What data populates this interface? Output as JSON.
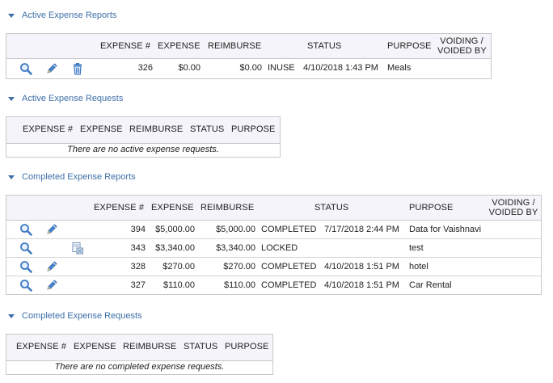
{
  "sections": {
    "active_reports": {
      "title": "Active Expense Reports"
    },
    "active_requests": {
      "title": "Active Expense Requests"
    },
    "completed_reports": {
      "title": "Completed Expense Reports"
    },
    "completed_requests": {
      "title": "Completed Expense Requests"
    }
  },
  "headers": {
    "expense_num": "EXPENSE #",
    "expense": "EXPENSE",
    "reimburse": "REIMBURSE",
    "status": "STATUS",
    "purpose": "PURPOSE",
    "voiding_line1": "VOIDING /",
    "voiding_line2": "VOIDED BY"
  },
  "active_reports_rows": [
    {
      "num": "326",
      "expense": "$0.00",
      "reimburse": "$0.00",
      "status": "INUSE",
      "date": "4/10/2018 1:43 PM",
      "purpose": "Meals"
    }
  ],
  "active_requests_empty": "There are no active expense requests.",
  "completed_reports_rows": [
    {
      "num": "394",
      "expense": "$5,000.00",
      "reimburse": "$5,000.00",
      "status": "COMPLETED",
      "date": "7/17/2018 2:44 PM",
      "purpose": "Data for Vaishnavi"
    },
    {
      "num": "343",
      "expense": "$3,340.00",
      "reimburse": "$3,340.00",
      "status": "LOCKED",
      "date": "",
      "purpose": "test"
    },
    {
      "num": "328",
      "expense": "$270.00",
      "reimburse": "$270.00",
      "status": "COMPLETED",
      "date": "4/10/2018 1:51 PM",
      "purpose": "hotel"
    },
    {
      "num": "327",
      "expense": "$110.00",
      "reimburse": "$110.00",
      "status": "COMPLETED",
      "date": "4/10/2018 1:51 PM",
      "purpose": "Car Rental"
    }
  ],
  "completed_requests_empty": "There are no completed expense requests.",
  "colors": {
    "accent": "#3e6fa8",
    "header_bg": "#f4f4fa",
    "border": "#c8c8c8"
  },
  "icons": [
    "search-icon",
    "edit-pencil-icon",
    "trash-icon",
    "document-lock-icon"
  ]
}
